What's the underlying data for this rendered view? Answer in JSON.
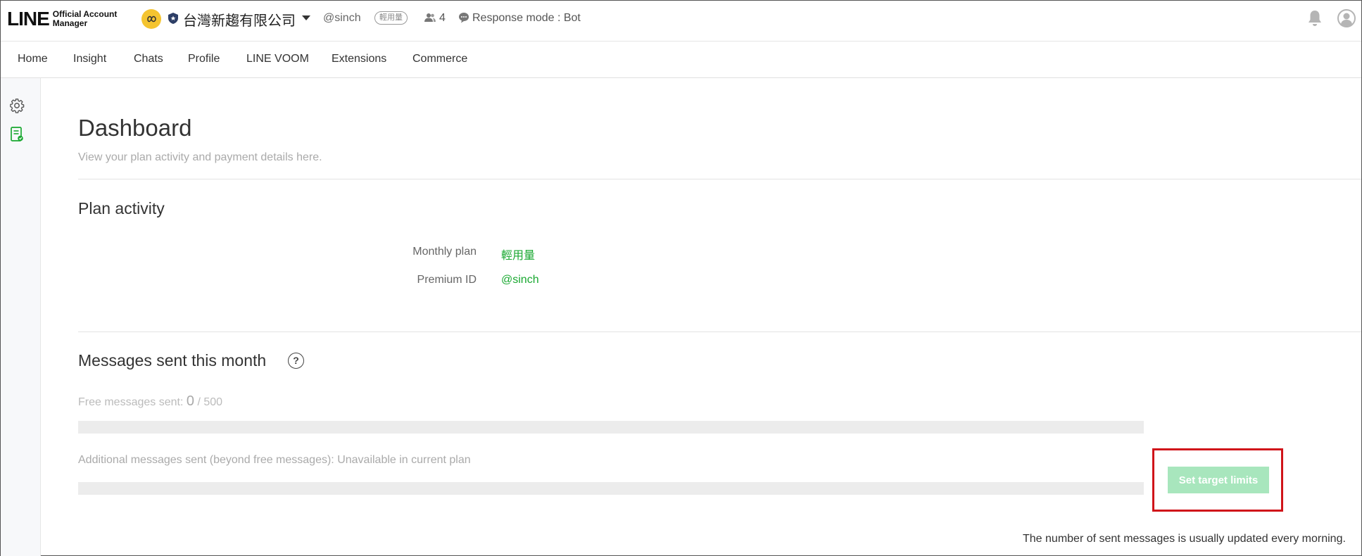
{
  "header": {
    "logo_main": "LINE",
    "logo_sub_line1": "Official Account",
    "logo_sub_line2": "Manager",
    "account_name": "台灣新趨有限公司",
    "account_id": "@sinch",
    "plan_badge": "輕用量",
    "friends_count": "4",
    "response_mode": "Response mode : Bot"
  },
  "nav": {
    "items": [
      "Home",
      "Insight",
      "Chats",
      "Profile",
      "LINE VOOM",
      "Extensions",
      "Commerce"
    ]
  },
  "main": {
    "title": "Dashboard",
    "subtitle": "View your plan activity and payment details here.",
    "plan_activity": {
      "title": "Plan activity",
      "monthly_plan_label": "Monthly plan",
      "monthly_plan_value": "輕用量",
      "premium_id_label": "Premium ID",
      "premium_id_value": "@sinch"
    },
    "messages": {
      "title": "Messages sent this month",
      "help": "?",
      "free_label": "Free messages sent:",
      "free_sent": "0",
      "free_total": "/ 500",
      "free_progress": 0,
      "additional_label": "Additional messages sent (beyond free messages): Unavailable in current plan",
      "additional_progress": 0,
      "target_button": "Set target limits",
      "footnote": "The number of sent messages is usually updated every morning."
    }
  },
  "colors": {
    "accent_green": "#19a830",
    "button_disabled": "#a8e6bd",
    "highlight_red": "#d0141a"
  }
}
